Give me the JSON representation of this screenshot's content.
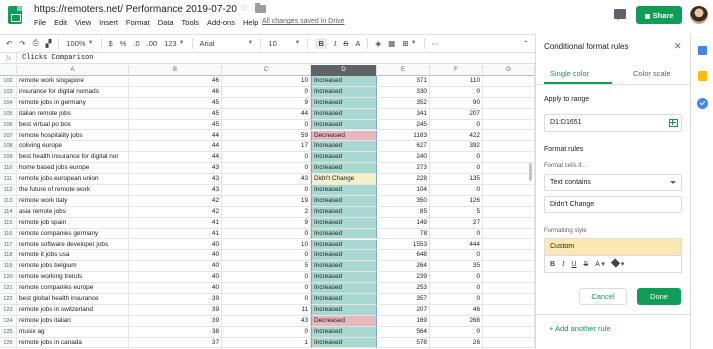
{
  "doc": {
    "title": "https://remoters.net/ Performance 2019-07-20",
    "save_status": "All changes saved in Drive",
    "menu": [
      "File",
      "Edit",
      "View",
      "Insert",
      "Format",
      "Data",
      "Tools",
      "Add-ons",
      "Help"
    ],
    "share_label": "Share"
  },
  "toolbar": {
    "zoom": "100%",
    "currency": "$",
    "percent": "%",
    "dec_less": ".0",
    "dec_more": ".00",
    "number_format": "123",
    "font": "Arial",
    "font_size": "10",
    "bold": "B",
    "italic": "I",
    "strike": "S",
    "text_color": "A",
    "more": "⋯",
    "collapse": "⌃"
  },
  "formula": {
    "fx": "fx",
    "content": "Clicks Comparison"
  },
  "columns": [
    "A",
    "B",
    "C",
    "D",
    "E",
    "F",
    "G"
  ],
  "rows": [
    {
      "n": "102",
      "a": "remote work singapore",
      "b": "46",
      "c": "10",
      "d": "Increased",
      "e": "371",
      "f": "110"
    },
    {
      "n": "103",
      "a": "insurance for digital nomads",
      "b": "46",
      "c": "0",
      "d": "Increased",
      "e": "330",
      "f": "0"
    },
    {
      "n": "104",
      "a": "remote jobs in germany",
      "b": "45",
      "c": "9",
      "d": "Increased",
      "e": "352",
      "f": "90"
    },
    {
      "n": "105",
      "a": "italian remote jobs",
      "b": "45",
      "c": "44",
      "d": "Increased",
      "e": "341",
      "f": "207"
    },
    {
      "n": "106",
      "a": "best virtual po box",
      "b": "45",
      "c": "0",
      "d": "Increased",
      "e": "245",
      "f": "0"
    },
    {
      "n": "107",
      "a": "remote hospitality jobs",
      "b": "44",
      "c": "59",
      "d": "Decreased",
      "e": "1183",
      "f": "422"
    },
    {
      "n": "108",
      "a": "coliving europe",
      "b": "44",
      "c": "17",
      "d": "Increased",
      "e": "627",
      "f": "392"
    },
    {
      "n": "109",
      "a": "best health insurance for digital nor",
      "b": "44",
      "c": "0",
      "d": "Increased",
      "e": "240",
      "f": "0"
    },
    {
      "n": "110",
      "a": "home based jobs europe",
      "b": "43",
      "c": "0",
      "d": "Increased",
      "e": "273",
      "f": "0"
    },
    {
      "n": "111",
      "a": "remote jobs european union",
      "b": "43",
      "c": "43",
      "d": "Didn't Change",
      "e": "228",
      "f": "135"
    },
    {
      "n": "112",
      "a": "the future of remote work",
      "b": "43",
      "c": "0",
      "d": "Increased",
      "e": "104",
      "f": "0"
    },
    {
      "n": "113",
      "a": "remote work italy",
      "b": "42",
      "c": "19",
      "d": "Increased",
      "e": "350",
      "f": "126"
    },
    {
      "n": "114",
      "a": "asia remote jobs",
      "b": "42",
      "c": "2",
      "d": "Increased",
      "e": "85",
      "f": "5"
    },
    {
      "n": "115",
      "a": "remote job spain",
      "b": "41",
      "c": "9",
      "d": "Increased",
      "e": "149",
      "f": "27"
    },
    {
      "n": "116",
      "a": "remote companies germany",
      "b": "41",
      "c": "0",
      "d": "Increased",
      "e": "78",
      "f": "0"
    },
    {
      "n": "117",
      "a": "remote software developer jobs",
      "b": "40",
      "c": "10",
      "d": "Increased",
      "e": "1553",
      "f": "444"
    },
    {
      "n": "118",
      "a": "remote it jobs usa",
      "b": "40",
      "c": "0",
      "d": "Increased",
      "e": "648",
      "f": "0"
    },
    {
      "n": "119",
      "a": "remote jobs belgium",
      "b": "40",
      "c": "5",
      "d": "Increased",
      "e": "264",
      "f": "35"
    },
    {
      "n": "120",
      "a": "remote working trends",
      "b": "40",
      "c": "0",
      "d": "Increased",
      "e": "239",
      "f": "0"
    },
    {
      "n": "121",
      "a": "remote companies europe",
      "b": "40",
      "c": "0",
      "d": "Increased",
      "e": "253",
      "f": "0"
    },
    {
      "n": "122",
      "a": "best global health insurance",
      "b": "39",
      "c": "0",
      "d": "Increased",
      "e": "357",
      "f": "0"
    },
    {
      "n": "123",
      "a": "remote jobs in switzerland",
      "b": "39",
      "c": "11",
      "d": "Increased",
      "e": "207",
      "f": "46"
    },
    {
      "n": "124",
      "a": "remote jobs italian",
      "b": "39",
      "c": "43",
      "d": "Decreased",
      "e": "169",
      "f": "268"
    },
    {
      "n": "125",
      "a": "musix ag",
      "b": "38",
      "c": "0",
      "d": "Increased",
      "e": "564",
      "f": "0"
    },
    {
      "n": "126",
      "a": "remote jobs in canada",
      "b": "37",
      "c": "1",
      "d": "Increased",
      "e": "578",
      "f": "26"
    }
  ],
  "status_colors": {
    "Increased": "#a8d8cf",
    "Decreased": "#e6b8be",
    "Didn't Change": "#f3efc8"
  },
  "panel": {
    "title": "Conditional format rules",
    "tab_single": "Single color",
    "tab_scale": "Color scale",
    "apply_label": "Apply to range",
    "range": "D1:D1651",
    "rules_label": "Format rules",
    "cells_if_label": "Format cells if...",
    "condition": "Text contains",
    "value": "Didn't Change",
    "style_label": "Formatting style",
    "style_name": "Custom",
    "cancel": "Cancel",
    "done": "Done",
    "add_rule": "+ Add another rule"
  }
}
